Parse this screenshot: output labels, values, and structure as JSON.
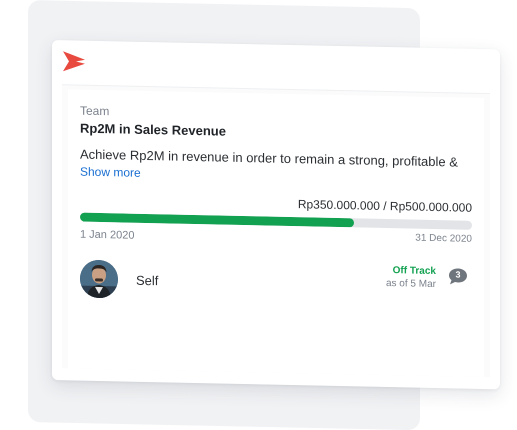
{
  "colors": {
    "brand": "#e84a3f",
    "progress_fill": "#12a150",
    "progress_track": "#e2e4e7",
    "status_off_track": "#12a150",
    "link": "#1a6fd1",
    "comment_badge": "#6f757c"
  },
  "goal": {
    "team_label": "Team",
    "title": "Rp2M in Sales Revenue",
    "description": "Achieve Rp2M in revenue in order to remain a strong, profitable &",
    "show_more": "Show more",
    "progress_text": "Rp350.000.000 / Rp500.000.000",
    "progress_fraction": 0.7,
    "start_date": "1 Jan 2020",
    "end_date": "31 Dec 2020"
  },
  "owner": {
    "name": "Self",
    "avatar_icon": "person-avatar"
  },
  "status": {
    "label": "Off Track",
    "as_of": "as of 5 Mar"
  },
  "comments": {
    "count": "3",
    "icon": "comment-bubble-icon"
  },
  "logo_icon": "brand-chevron-logo"
}
